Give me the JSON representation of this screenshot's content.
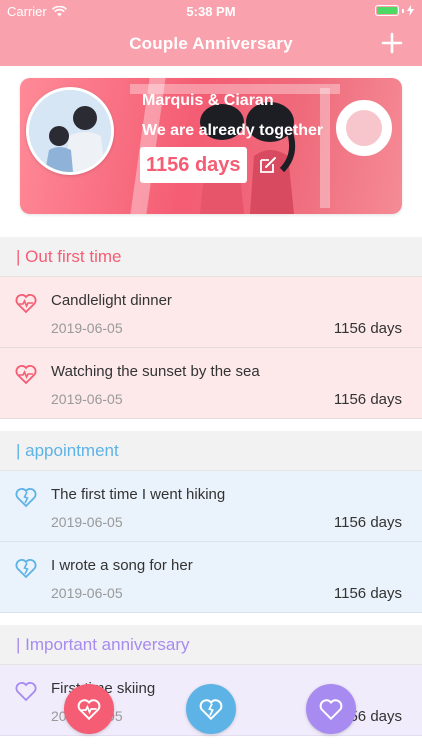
{
  "status": {
    "carrier": "Carrier",
    "time": "5:38 PM"
  },
  "nav": {
    "title": "Couple Anniversary"
  },
  "banner": {
    "names": "Marquis & Ciaran",
    "subtitle": "We are already together",
    "days": "1156 days"
  },
  "sections": [
    {
      "title": "| Out first time",
      "color": "#f45d73",
      "items": [
        {
          "title": "Candlelight dinner",
          "date": "2019-06-05",
          "days": "1156 days"
        },
        {
          "title": "Watching the sunset by the sea",
          "date": "2019-06-05",
          "days": "1156 days"
        }
      ]
    },
    {
      "title": "| appointment",
      "color": "#5db3e6",
      "items": [
        {
          "title": "The first time I went hiking",
          "date": "2019-06-05",
          "days": "1156 days"
        },
        {
          "title": "I wrote a song for her",
          "date": "2019-06-05",
          "days": "1156 days"
        }
      ]
    },
    {
      "title": "| Important anniversary",
      "color": "#a78bf0",
      "items": [
        {
          "title": "First time skiing",
          "date": "2019-06-05",
          "days": "1156 days"
        }
      ]
    }
  ],
  "fabs": [
    {
      "icon": "heart-pulse-icon",
      "color": "#f45d73"
    },
    {
      "icon": "broken-heart-icon",
      "color": "#5db3e6"
    },
    {
      "icon": "heart-outline-icon",
      "color": "#a78bf0"
    }
  ]
}
